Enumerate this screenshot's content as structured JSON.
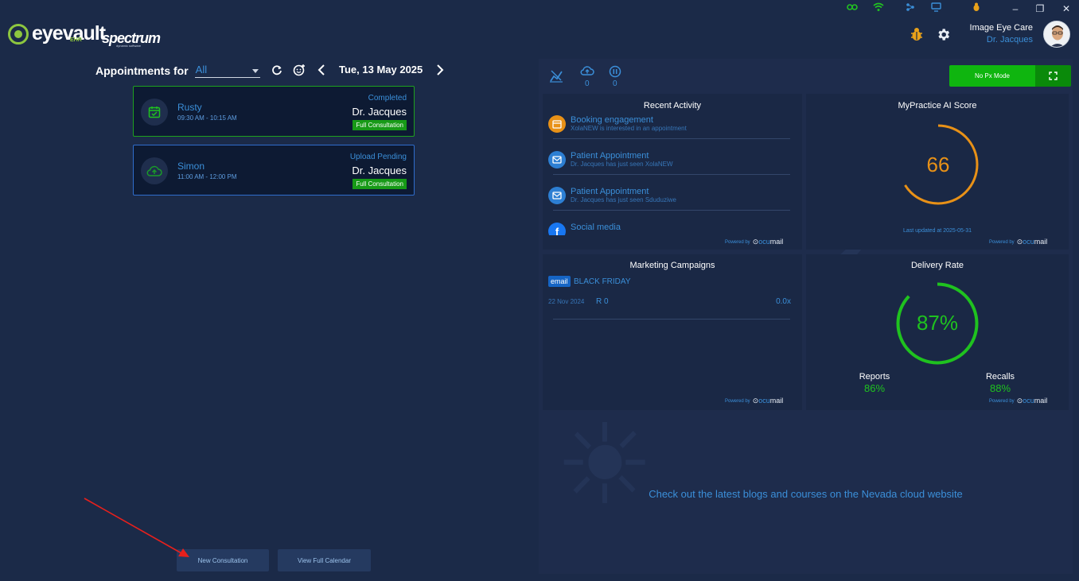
{
  "header": {
    "brand_primary": "eyevault",
    "brand_ehr": "EHR",
    "brand_secondary": "spectrum",
    "brand_secondary_sub": "dynamic software",
    "practice_name": "Image Eye Care",
    "doctor_name": "Dr. Jacques"
  },
  "appointments": {
    "title": "Appointments for",
    "filter_value": "All",
    "date": "Tue, 13 May 2025",
    "items": [
      {
        "name": "Rusty",
        "time": "09:30 AM - 10:15 AM",
        "status": "Completed",
        "doctor": "Dr. Jacques",
        "type": "Full Consultation"
      },
      {
        "name": "Simon",
        "time": "11:00 AM - 12:00 PM",
        "status": "Upload Pending",
        "doctor": "Dr. Jacques",
        "type": "Full Consultation"
      }
    ],
    "new_consultation_label": "New Consultation",
    "view_calendar_label": "View Full Calendar"
  },
  "toolbar": {
    "upload_count": "0",
    "paused_count": "0",
    "mode_label": "No Px Mode"
  },
  "recent_activity": {
    "title": "Recent Activity",
    "items": [
      {
        "title": "Booking engagement",
        "subtitle": "XolaNEW is interested in an appointment"
      },
      {
        "title": "Patient Appointment",
        "subtitle": "Dr. Jacques has just seen XolaNEW"
      },
      {
        "title": "Patient Appointment",
        "subtitle": "Dr. Jacques has just seen Sduduziwe"
      },
      {
        "title": "Social media",
        "subtitle": "..."
      }
    ]
  },
  "ai_score": {
    "title": "MyPractice AI Score",
    "score": "66",
    "score_fraction": 0.66,
    "last_updated": "Last updated at 2025-05-31"
  },
  "marketing": {
    "title": "Marketing Campaigns",
    "campaign_tag": "email",
    "campaign_name": "BLACK FRIDAY",
    "campaign_date": "22 Nov 2024",
    "campaign_revenue": "R 0",
    "campaign_ratio": "0.0x"
  },
  "delivery": {
    "title": "Delivery Rate",
    "rate": "87%",
    "rate_fraction": 0.87,
    "reports_label": "Reports",
    "reports_value": "86%",
    "recalls_label": "Recalls",
    "recalls_value": "88%"
  },
  "powered": {
    "label": "Powered by",
    "brand_a": "ocu",
    "brand_b": "mail"
  },
  "blog_message": "Check out the latest blogs and courses on the Nevada cloud website",
  "colors": {
    "background": "#1b2a48",
    "accent_blue": "#3b8fd9",
    "success_green": "#1fc21f",
    "score_orange": "#e89117"
  }
}
